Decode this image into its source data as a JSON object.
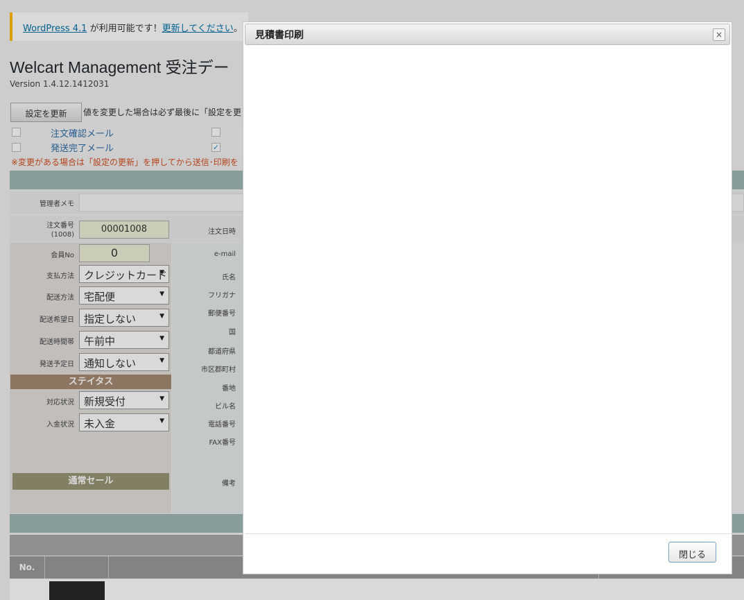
{
  "notice": {
    "link_label": "WordPress 4.1",
    "middle_text": " が利用可能です！",
    "update_link": "更新してください",
    "tail": "。"
  },
  "page": {
    "title": "Welcart Management 受注デー",
    "version": "Version 1.4.12.1412031"
  },
  "settings": {
    "update_button": "設定を更新",
    "update_note": "値を変更した場合は必ず最後に「設定を更",
    "mail_items": [
      {
        "label": "注文確認メール",
        "checked": false
      },
      {
        "label": "発送完了メール",
        "checked": true
      }
    ],
    "warning": "※変更がある場合は「設定の更新」を押してから送信･印刷を"
  },
  "order": {
    "memo_label": "管理者メモ",
    "order_no_label": "注文番号",
    "order_no_sub": "(1008)",
    "order_no_value": "00001008",
    "order_date_label": "注文日時",
    "member_label": "会員No",
    "member_value": "0",
    "fields": [
      {
        "label": "支払方法",
        "value": "クレジットカード"
      },
      {
        "label": "配送方法",
        "value": "宅配便"
      },
      {
        "label": "配送希望日",
        "value": "指定しない"
      },
      {
        "label": "配送時間帯",
        "value": "午前中"
      },
      {
        "label": "発送予定日",
        "value": "通知しない"
      }
    ],
    "status_heading": "ステイタス",
    "status_fields": [
      {
        "label": "対応状況",
        "value": "新規受付"
      },
      {
        "label": "入金状況",
        "value": "未入金"
      }
    ],
    "sale_label": "通常セール",
    "customer_labels": [
      "e-mail",
      "氏名",
      "フリガナ",
      "郵便番号",
      "国",
      "都道府県",
      "市区郡町村",
      "番地",
      "ビル名",
      "電話番号",
      "FAX番号"
    ],
    "note_label": "備考"
  },
  "table": {
    "no_header": "No."
  },
  "dialog": {
    "title": "見積書印刷",
    "close_icon": "×",
    "close_button": "閉じる"
  },
  "colors": {
    "notice_border": "#ffba00",
    "band": "#a0b8b7",
    "status_head": "#a68b73",
    "sale_head": "#999676"
  }
}
